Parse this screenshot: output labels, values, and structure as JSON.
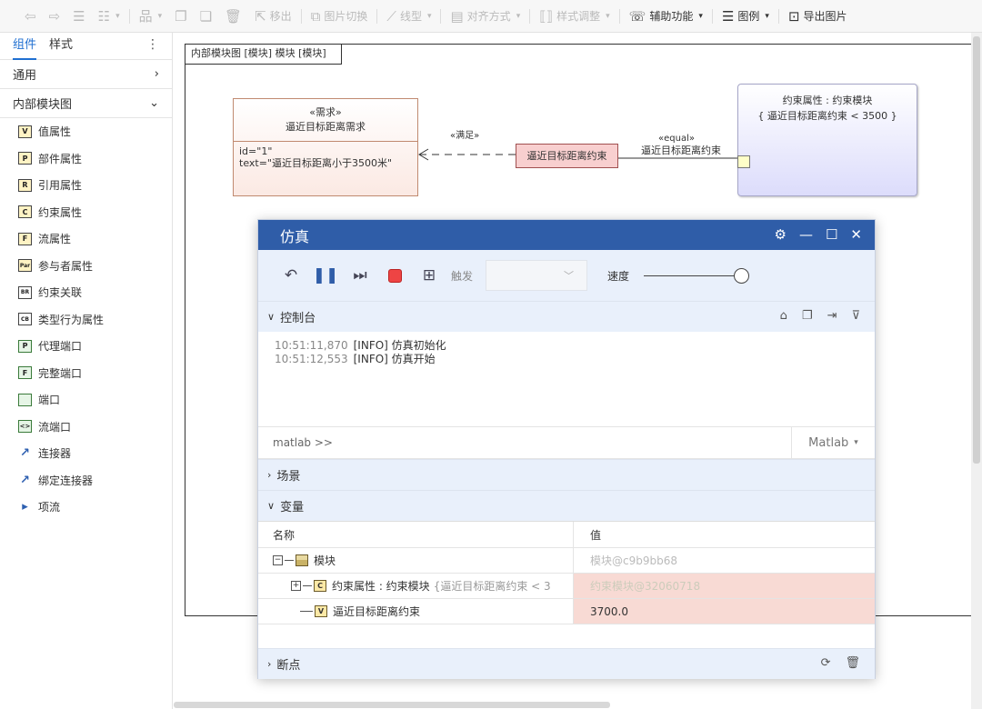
{
  "toolbar": {
    "back": "←",
    "forward": "→",
    "move_out": "移出",
    "image_switch": "图片切换",
    "line_type": "线型",
    "align": "对齐方式",
    "style_adjust": "样式调整",
    "assist": "辅助功能",
    "legend": "图例",
    "export": "导出图片"
  },
  "left_panel": {
    "tabs": [
      "组件",
      "样式"
    ],
    "sections": {
      "general": "通用",
      "ibd": "内部模块图"
    },
    "items": [
      {
        "icon": "V",
        "label": "值属性"
      },
      {
        "icon": "P",
        "label": "部件属性"
      },
      {
        "icon": "R",
        "label": "引用属性"
      },
      {
        "icon": "C",
        "label": "约束属性"
      },
      {
        "icon": "F",
        "label": "流属性"
      },
      {
        "icon": "Par",
        "label": "参与者属性"
      },
      {
        "icon": "BR",
        "label": "约束关联"
      },
      {
        "icon": "CB",
        "label": "类型行为属性"
      },
      {
        "icon": "P",
        "label": "代理端口"
      },
      {
        "icon": "F",
        "label": "完整端口"
      },
      {
        "icon": "",
        "label": "端口"
      },
      {
        "icon": "<>",
        "label": "流端口"
      },
      {
        "icon": "↗",
        "label": "连接器"
      },
      {
        "icon": "↗",
        "label": "绑定连接器"
      },
      {
        "icon": "▸",
        "label": "项流"
      }
    ]
  },
  "diagram": {
    "frame_title": "内部模块图 [模块] 模块 [模块]",
    "requirement": {
      "stereotype": "«需求»",
      "name": "逼近目标距离需求",
      "id_line": "id=\"1\"",
      "text_line": "text=\"逼近目标距离小于3500米\""
    },
    "satisfy_label": "«满足»",
    "constraint_usage": "逼近目标距离约束",
    "equal_label": "«equal»",
    "equal_target": "逼近目标距离约束",
    "constraint_block": {
      "title": "约束属性 : 约束模块",
      "expr": "{ 逼近目标距离约束 < 3500 }"
    }
  },
  "sim": {
    "title": "仿真",
    "trigger_label": "触发",
    "speed_label": "速度",
    "console_header": "控制台",
    "logs": [
      {
        "time": "10:51:11,870",
        "msg": "[INFO] 仿真初始化"
      },
      {
        "time": "10:51:12,553",
        "msg": "[INFO] 仿真开始"
      }
    ],
    "cmd_prompt": "matlab  >>",
    "cmd_lang": "Matlab",
    "scene_header": "场景",
    "vars_header": "变量",
    "col_name": "名称",
    "col_value": "值",
    "vars": [
      {
        "name": "模块",
        "value": "模块@c9b9bb68"
      },
      {
        "name": "约束属性 : 约束模块",
        "extra": "{逼近目标距离约束 < 3",
        "value": "约束模块@32060718"
      },
      {
        "name": "逼近目标距离约束",
        "value": "3700.0"
      }
    ],
    "breakpoints_header": "断点"
  }
}
